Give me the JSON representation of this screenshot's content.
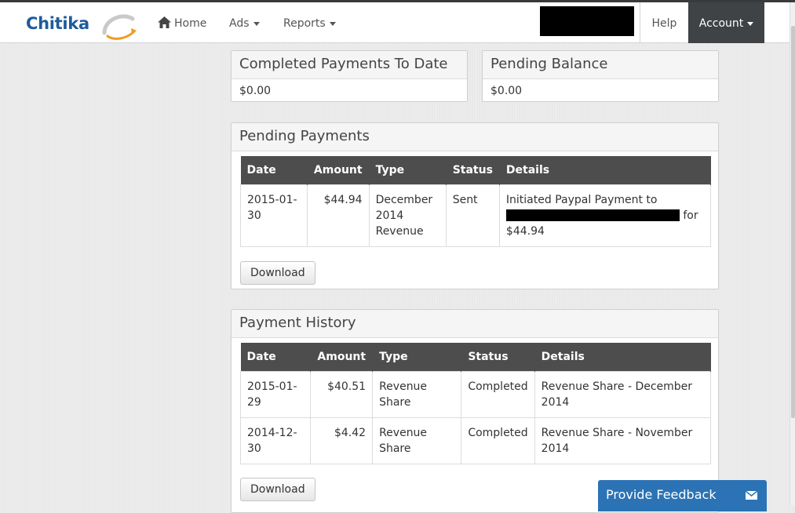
{
  "brand": {
    "name": "Chitika",
    "logo_icon": "swoosh-logo-icon"
  },
  "nav": {
    "home": "Home",
    "ads": "Ads",
    "reports": "Reports",
    "help": "Help",
    "account": "Account"
  },
  "summary": {
    "completed": {
      "title": "Completed Payments To Date",
      "value": "$0.00"
    },
    "pending": {
      "title": "Pending Balance",
      "value": "$0.00"
    }
  },
  "pending_payments": {
    "title": "Pending Payments",
    "columns": [
      "Date",
      "Amount",
      "Type",
      "Status",
      "Details"
    ],
    "rows": [
      {
        "date": "2015-01-30",
        "amount": "$44.94",
        "type": "December 2014 Revenue",
        "status": "Sent",
        "details_prefix": "Initiated Paypal Payment to",
        "details_suffix": "for $44.94"
      }
    ],
    "download": "Download"
  },
  "payment_history": {
    "title": "Payment History",
    "columns": [
      "Date",
      "Amount",
      "Type",
      "Status",
      "Details"
    ],
    "rows": [
      {
        "date": "2015-01-29",
        "amount": "$40.51",
        "type": "Revenue Share",
        "status": "Completed",
        "details": "Revenue Share - December 2014"
      },
      {
        "date": "2014-12-30",
        "amount": "$4.42",
        "type": "Revenue Share",
        "status": "Completed",
        "details": "Revenue Share - November 2014"
      }
    ],
    "download": "Download"
  },
  "feedback": {
    "label": "Provide Feedback",
    "icon": "envelope-icon"
  },
  "colors": {
    "brand_blue": "#1d5c9c",
    "accent_orange": "#f39a1e",
    "table_header": "#4d4d4d",
    "account_bg": "#3f4346",
    "feedback_bg": "#2b73b4"
  }
}
